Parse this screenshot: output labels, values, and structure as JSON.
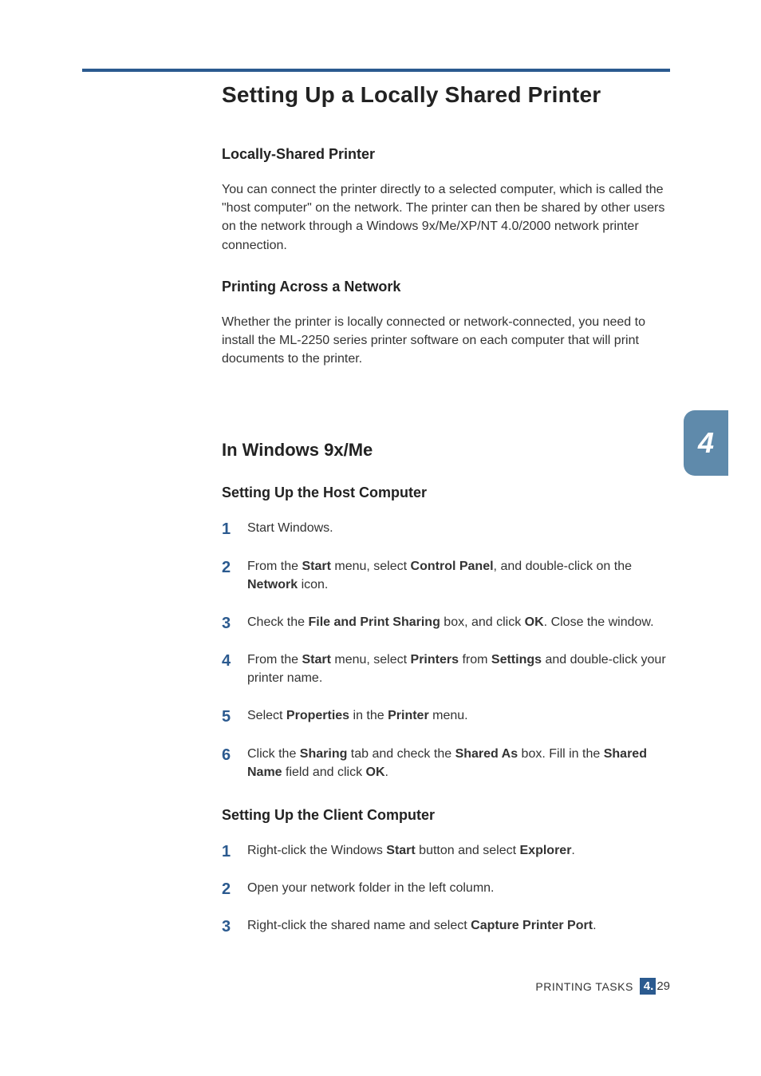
{
  "title": "Setting Up a Locally Shared Printer",
  "sections": {
    "locally_shared": {
      "heading": "Locally-Shared Printer",
      "body": "You can connect the printer directly to a selected computer, which is called the \"host computer\" on the network. The printer can then be shared by other users on the network through a Windows 9x/Me/XP/NT 4.0/2000 network printer connection."
    },
    "printing_network": {
      "heading": "Printing Across a Network",
      "body": "Whether the printer is locally connected or network-connected, you need to install the ML-2250 series printer software on each computer that will print documents to the printer."
    },
    "windows9x": {
      "heading": "In Windows 9x/Me",
      "host": {
        "heading": "Setting Up the Host Computer",
        "steps": [
          "Start Windows.",
          "From the <b>Start</b> menu, select <b>Control Panel</b>, and double-click on the <b>Network</b> icon.",
          "Check the <b>File and Print Sharing</b> box, and click <b>OK</b>. Close the window.",
          "From the <b>Start</b> menu, select <b>Printers</b> from <b>Settings</b> and double-click your printer name.",
          "Select <b>Properties</b> in the <b>Printer</b> menu.",
          "Click the <b>Sharing</b> tab and check the <b>Shared As</b> box. Fill in the <b>Shared Name</b> field and click <b>OK</b>."
        ]
      },
      "client": {
        "heading": "Setting Up the Client Computer",
        "steps": [
          "Right-click the Windows <b>Start</b> button and select <b>Explorer</b>.",
          "Open your network folder in the left column.",
          "Right-click the shared name and select <b>Capture Printer Port</b>."
        ]
      }
    }
  },
  "chapter_tab": "4",
  "footer": {
    "label": "PRINTING TASKS",
    "chapter": "4.",
    "page": "29"
  }
}
